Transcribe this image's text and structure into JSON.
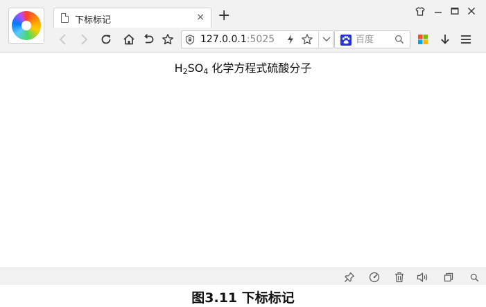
{
  "tab": {
    "title": "下标标记",
    "close_glyph": "×"
  },
  "new_tab_glyph": "+",
  "address": {
    "host": "127.0.0.1",
    "port": ":5025"
  },
  "search": {
    "placeholder": "百度"
  },
  "page": {
    "formula": {
      "h": "H",
      "sub1": "2",
      "so": "SO",
      "sub2": "4",
      "text": " 化学方程式硫酸分子"
    }
  },
  "caption": "图3.11 下标标记",
  "icons": {
    "skin": "shirt-icon",
    "minimize": "minimize-icon",
    "maximize": "maximize-icon",
    "close": "close-icon",
    "back": "chevron-left-icon",
    "forward": "chevron-right-icon",
    "refresh": "refresh-icon",
    "home": "home-icon",
    "undo": "undo-icon",
    "favorite": "star-outline-icon",
    "secure": "shield-icon",
    "speed": "lightning-icon",
    "bookmark": "star-icon",
    "dropdown": "chevron-down-icon",
    "search_engine": "baidu-paw-icon",
    "search": "magnifier-icon",
    "apps": "apps-grid-icon",
    "download": "download-arrow-icon",
    "menu": "hamburger-menu-icon"
  },
  "colors": {
    "baidu_blue": "#2932e1",
    "chrome_bg": "#f2f2f2"
  }
}
